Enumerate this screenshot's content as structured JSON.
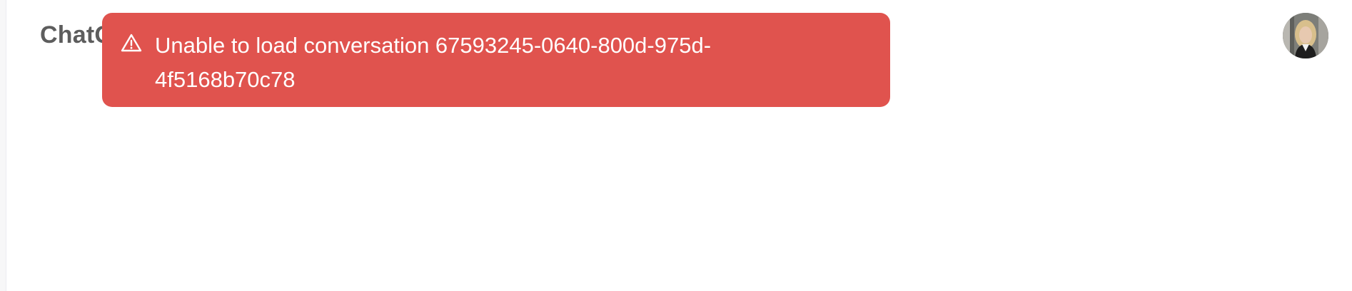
{
  "header": {
    "app_title": "ChatGPT"
  },
  "toast": {
    "message": "Unable to load conversation 67593245-0640-800d-975d-4f5168b70c78",
    "background_color": "#e0534e",
    "icon": "warning-triangle-icon"
  },
  "user": {
    "avatar_icon": "user-avatar-photo"
  }
}
